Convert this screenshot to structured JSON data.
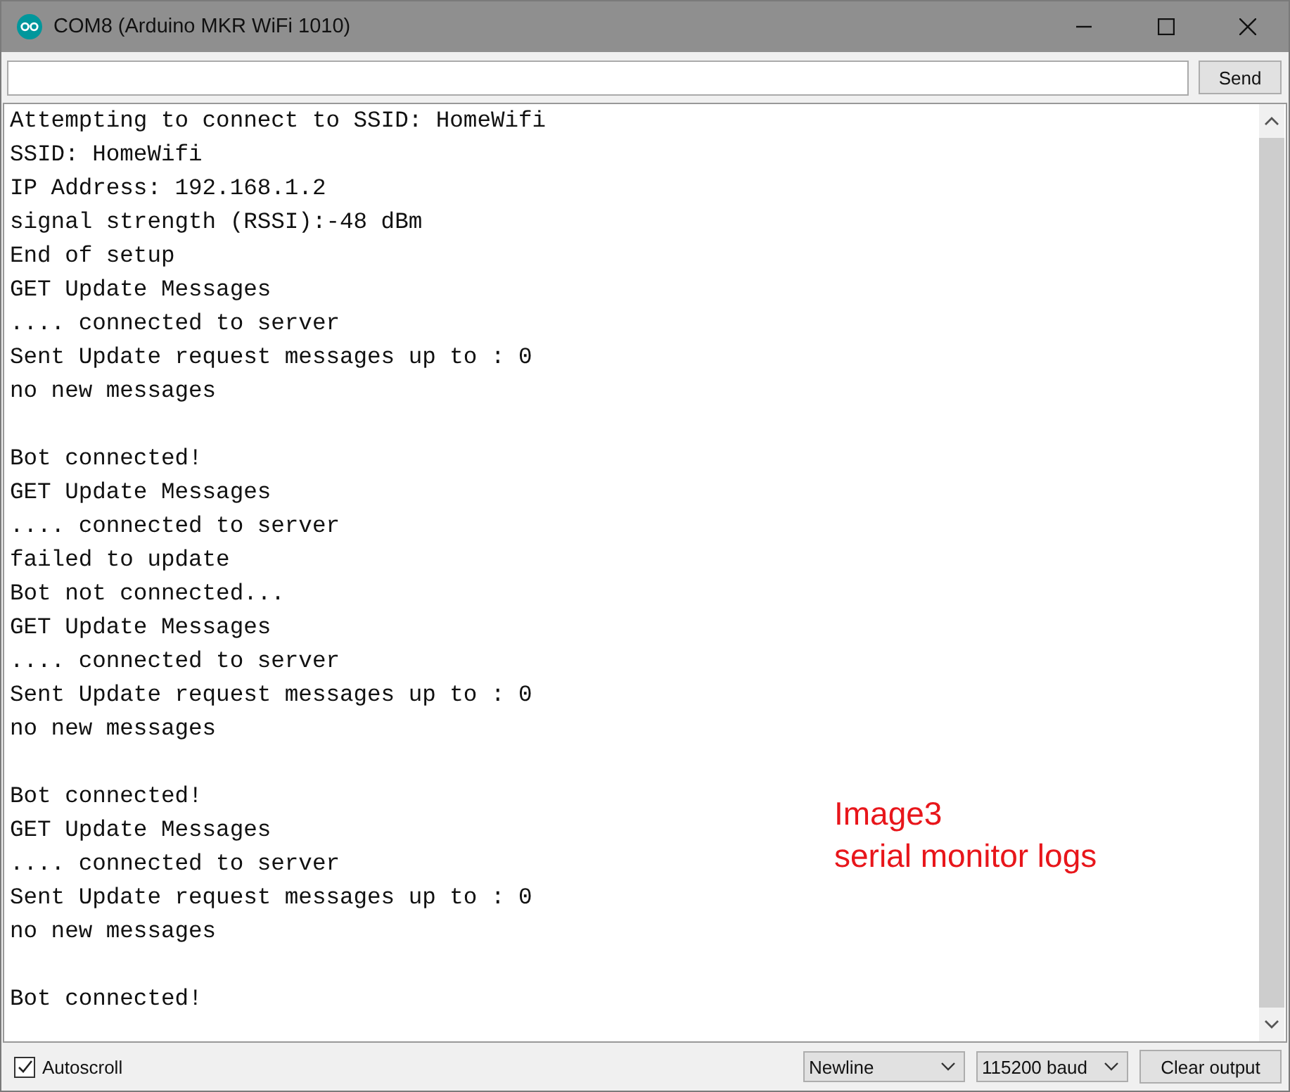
{
  "window": {
    "title": "COM8 (Arduino MKR WiFi 1010)"
  },
  "send": {
    "label": "Send"
  },
  "log": [
    {
      "lines": [
        "Attempting to connect to SSID: HomeWifi",
        "SSID: HomeWifi",
        "IP Address: 192.168.1.2",
        "signal strength (RSSI):-48 dBm",
        "End of setup",
        "GET Update Messages",
        ".... connected to server",
        "Sent Update request messages up to : 0",
        "no new messages"
      ]
    },
    {
      "lines": [
        "Bot connected!",
        "GET Update Messages",
        ".... connected to server",
        "failed to update",
        "Bot not connected...",
        "GET Update Messages",
        ".... connected to server",
        "Sent Update request messages up to : 0",
        "no new messages"
      ]
    },
    {
      "lines": [
        "Bot connected!",
        "GET Update Messages",
        ".... connected to server",
        "Sent Update request messages up to : 0",
        "no new messages"
      ]
    },
    {
      "lines": [
        "Bot connected!"
      ]
    }
  ],
  "annotation": {
    "lines": [
      "Image3",
      "serial monitor logs"
    ]
  },
  "footer": {
    "autoscroll": {
      "label": "Autoscroll",
      "checked": true
    },
    "line_ending": "Newline",
    "baud": "115200 baud",
    "clear": "Clear output"
  }
}
